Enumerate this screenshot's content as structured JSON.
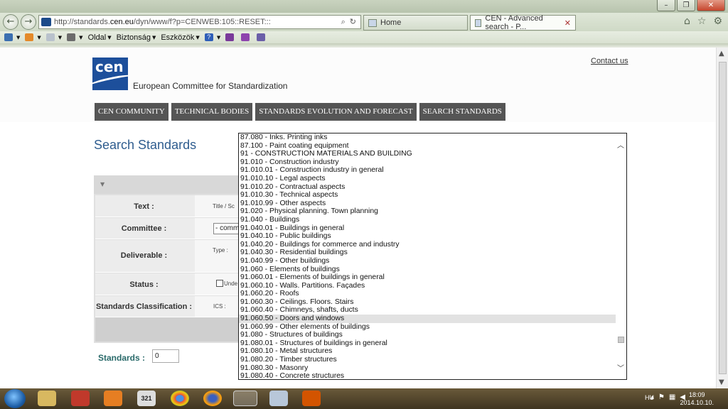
{
  "browser": {
    "url_prefix": "http://standards.",
    "url_host": "cen.eu",
    "url_path": "/dyn/www/f?p=CENWEB:105::RESET:::",
    "search_glyph": "⌕",
    "refresh_glyph": "↻",
    "tabs": [
      {
        "label": "Home",
        "active": false
      },
      {
        "label": "CEN - Advanced search - P...",
        "active": true
      }
    ],
    "window_buttons": {
      "minimize": "–",
      "maximize": "❐",
      "close": "✕"
    },
    "nav_back": "←",
    "nav_forward": "→",
    "right_icons": {
      "home": "⌂",
      "favorites": "☆",
      "settings": "⚙"
    },
    "command_bar": {
      "page": "Oldal",
      "safety": "Biztonság",
      "tools": "Eszközök",
      "help": "?"
    }
  },
  "header": {
    "logo_text": "cen",
    "org_name": "European Committee for Standardization",
    "contact_link": "Contact us",
    "menu": [
      "CEN COMMUNITY",
      "TECHNICAL BODIES",
      "STANDARDS EVOLUTION AND FORECAST",
      "SEARCH STANDARDS"
    ]
  },
  "search": {
    "title": "Search Standards",
    "fields": {
      "text_label": "Text :",
      "text_hint": "Title / Sc",
      "committee_label": "Committee :",
      "committee_value": "- comm",
      "deliverable_label": "Deliverable :",
      "deliverable_hint": "Type :",
      "status_label": "Status :",
      "status_check_label": "Unde",
      "classification_label": "Standards Classification :",
      "classification_hint": "ICS :"
    },
    "standards_label": "Standards :",
    "standards_value": "0"
  },
  "dropdown": {
    "items": [
      "87.080 - Inks. Printing inks",
      "87.100 - Paint coating equipment",
      "91 - CONSTRUCTION MATERIALS AND BUILDING",
      "91.010 - Construction industry",
      "91.010.01 - Construction industry in general",
      "91.010.10 - Legal aspects",
      "91.010.20 - Contractual aspects",
      "91.010.30 - Technical aspects",
      "91.010.99 - Other aspects",
      "91.020 - Physical planning. Town planning",
      "91.040 - Buildings",
      "91.040.01 - Buildings in general",
      "91.040.10 - Public buildings",
      "91.040.20 - Buildings for commerce and industry",
      "91.040.30 - Residential buildings",
      "91.040.99 - Other buildings",
      "91.060 - Elements of buildings",
      "91.060.01 - Elements of buildings in general",
      "91.060.10 - Walls. Partitions. Façades",
      "91.060.20 - Roofs",
      "91.060.30 - Ceilings. Floors. Stairs",
      "91.060.40 - Chimneys, shafts, ducts",
      "91.060.50 - Doors and windows",
      "91.060.99 - Other elements of buildings",
      "91.080 - Structures of buildings",
      "91.080.01 - Structures of buildings in general",
      "91.080.10 - Metal structures",
      "91.080.20 - Timber structures",
      "91.080.30 - Masonry",
      "91.080.40 - Concrete structures"
    ],
    "selected_index": 22,
    "scroll_up": "︿",
    "scroll_down": "﹀"
  },
  "taskbar": {
    "language": "HU",
    "time": "18:09",
    "date": "2014.10.10.",
    "calendar_day": "321"
  }
}
